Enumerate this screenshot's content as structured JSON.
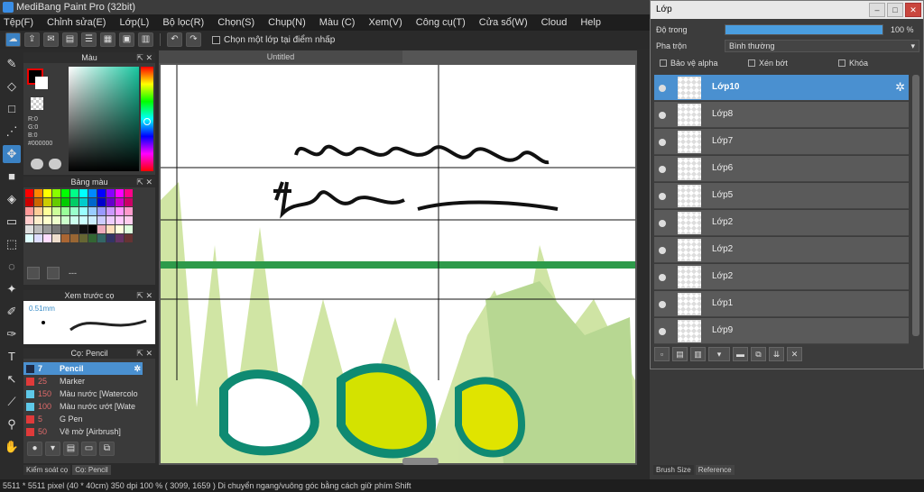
{
  "app": {
    "title": "MediBang Paint Pro (32bit)"
  },
  "menu": [
    "Tệp(F)",
    "Chỉnh sửa(E)",
    "Lớp(L)",
    "Bộ lọc(R)",
    "Chọn(S)",
    "Chụp(N)",
    "Màu (C)",
    "Xem(V)",
    "Công cụ(T)",
    "Cửa sổ(W)",
    "Cloud",
    "Help"
  ],
  "toolbar": {
    "checkbox_label": "Chọn một lớp tại điểm nhấp"
  },
  "color_panel": {
    "title": "Màu",
    "r": "R:0",
    "g": "G:0",
    "b": "B:0",
    "hex": "#000000"
  },
  "palette_panel": {
    "title": "Bảng màu",
    "dash": "---"
  },
  "preview_panel": {
    "title": "Xem trước cọ",
    "size": "0.51mm"
  },
  "brush_panel": {
    "title": "Cọ: Pencil",
    "items": [
      {
        "size": "7",
        "name": "Pencil",
        "color": "#1f2a44",
        "selected": true
      },
      {
        "size": "25",
        "name": "Marker",
        "color": "#e03a3a"
      },
      {
        "size": "150",
        "name": "Màu nước [Watercolo",
        "color": "#5ec8e8"
      },
      {
        "size": "100",
        "name": "Màu nước ướt [Wate",
        "color": "#5ec8e8"
      },
      {
        "size": "5",
        "name": "G Pen",
        "color": "#e03a3a"
      },
      {
        "size": "50",
        "name": "Vẽ mờ [Airbrush]",
        "color": "#e03a3a"
      }
    ]
  },
  "bottom_tabs": [
    "Kiểm soát cọ",
    "Cọ: Pencil"
  ],
  "document": {
    "tab": "Untitled"
  },
  "layer_window": {
    "title": "Lớp",
    "opacity_label": "Độ trong",
    "opacity_value": "100 %",
    "opacity": 1.0,
    "blend_label": "Pha trộn",
    "blend_value": "Bình thường",
    "checks": [
      "Bảo vệ alpha",
      "Xén bớt",
      "Khóa"
    ],
    "layers": [
      {
        "name": "Lớp10",
        "selected": true
      },
      {
        "name": "Lớp8"
      },
      {
        "name": "Lớp7"
      },
      {
        "name": "Lớp6"
      },
      {
        "name": "Lớp5"
      },
      {
        "name": "Lớp2"
      },
      {
        "name": "Lớp2"
      },
      {
        "name": "Lớp2"
      },
      {
        "name": "Lớp1"
      },
      {
        "name": "Lớp9"
      }
    ]
  },
  "right_tabs": [
    "Brush Size",
    "Reference"
  ],
  "status": {
    "text": "5511 * 5511 pixel   (40 * 40cm)   350 dpi   100 %   ( 3099, 1659 )   Di chuyển ngang/vuông góc bằng cách giữ phím Shift"
  },
  "colors": {
    "accent": "#3b82c4",
    "layer_selected": "#4a90d0"
  }
}
